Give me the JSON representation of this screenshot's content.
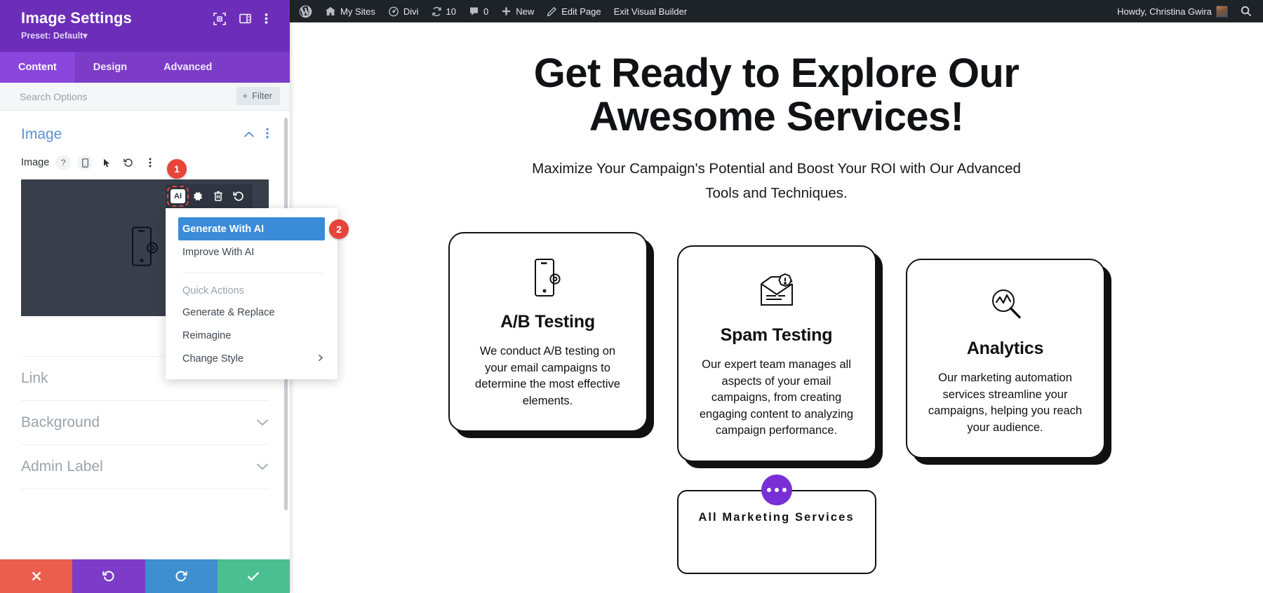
{
  "settings_panel": {
    "title": "Image Settings",
    "preset": "Preset: Default",
    "preset_caret": "▾",
    "header_icons": [
      {
        "name": "expand-icon",
        "label": "Expand settings"
      },
      {
        "name": "layout-icon",
        "label": "Change panel layout"
      },
      {
        "name": "more-vertical-icon",
        "label": "More options"
      }
    ],
    "tabs": [
      {
        "label": "Content",
        "active": true
      },
      {
        "label": "Design",
        "active": false
      },
      {
        "label": "Advanced",
        "active": false
      }
    ],
    "search": {
      "placeholder": "Search Options",
      "value": ""
    },
    "filter_button": {
      "label": "Filter",
      "plus": "+"
    },
    "section": {
      "title": "Image",
      "collapse_caret": "⌃",
      "more": "⋮"
    },
    "image_field": {
      "label": "Image",
      "icons": [
        "?",
        "phone-icon",
        "cursor-icon",
        "reset-icon",
        "more-vertical-icon"
      ]
    },
    "collapsed_sections": [
      {
        "label": "Link",
        "caret": ""
      },
      {
        "label": "Background",
        "caret": "⌄"
      },
      {
        "label": "Admin Label",
        "caret": "⌄"
      }
    ],
    "footer_buttons": [
      {
        "name": "discard-button",
        "glyph": "✖",
        "color": "#eb5d4c"
      },
      {
        "name": "undo-button",
        "glyph": "↺",
        "color": "#7c3cc7"
      },
      {
        "name": "redo-button",
        "glyph": "↻",
        "color": "#3e8ed0"
      },
      {
        "name": "save-button",
        "glyph": "✔",
        "color": "#4bbf92"
      }
    ]
  },
  "ai_toolbar": {
    "items": [
      {
        "name": "ai-button",
        "label": "AI",
        "selected": true
      },
      {
        "name": "settings-gear-icon",
        "label": "Settings"
      },
      {
        "name": "trash-icon",
        "label": "Delete"
      },
      {
        "name": "undo-icon",
        "label": "Reset"
      }
    ]
  },
  "ai_menu": {
    "primary": [
      {
        "label": "Generate With AI",
        "highlighted": true
      },
      {
        "label": "Improve With AI",
        "highlighted": false
      }
    ],
    "group_label": "Quick Actions",
    "quick_actions": [
      {
        "label": "Generate & Replace",
        "submenu": false
      },
      {
        "label": "Reimagine",
        "submenu": false
      },
      {
        "label": "Change Style",
        "submenu": true,
        "arrow": "▶"
      }
    ]
  },
  "badges": [
    {
      "number": "1"
    },
    {
      "number": "2"
    }
  ],
  "admin_bar": {
    "left_items": [
      {
        "name": "wordpress-logo-icon",
        "label": ""
      },
      {
        "name": "my-sites-menu",
        "label": "My Sites",
        "icon": "sites-icon"
      },
      {
        "name": "divi-menu",
        "label": "Divi",
        "icon": "divi-icon"
      },
      {
        "name": "updates-count",
        "label": "10",
        "icon": "updates-icon"
      },
      {
        "name": "comments-count",
        "label": "0",
        "icon": "comment-icon"
      },
      {
        "name": "new-menu",
        "label": "New",
        "icon": "plus-icon"
      },
      {
        "name": "edit-page-link",
        "label": "Edit Page",
        "icon": "pencil-icon"
      },
      {
        "name": "exit-visual-builder-link",
        "label": "Exit Visual Builder",
        "icon": ""
      }
    ],
    "right_items": [
      {
        "name": "howdy-user",
        "label": "Howdy, Christina Gwira"
      },
      {
        "name": "search-icon",
        "label": ""
      }
    ]
  },
  "page": {
    "hero": {
      "heading": "Get Ready to Explore Our Awesome Services!",
      "subheading": "Maximize Your Campaign's Potential and Boost Your ROI with Our Advanced Tools and Techniques."
    },
    "cards": [
      {
        "icon": "phone-gear-icon",
        "title": "A/B Testing",
        "body": "We conduct A/B testing on your email campaigns to determine the most effective elements."
      },
      {
        "icon": "spam-envelope-icon",
        "title": "Spam Testing",
        "body": "Our expert team manages all aspects of your email campaigns, from creating engaging content to analyzing campaign performance."
      },
      {
        "icon": "analytics-magnifier-icon",
        "title": "Analytics",
        "body": "Our marketing automation services streamline your campaigns, helping you reach your audience."
      }
    ],
    "bottom_card": {
      "title": "All Marketing Services",
      "dots_button_label": "•••"
    }
  },
  "colors": {
    "panel_header": "#6c2eb9",
    "tab_active": "#8b46dd",
    "menu_highlight": "#3a8bd8",
    "badge": "#e8443b",
    "adminbar": "#1d2327",
    "accent_purple": "#7830d6"
  }
}
